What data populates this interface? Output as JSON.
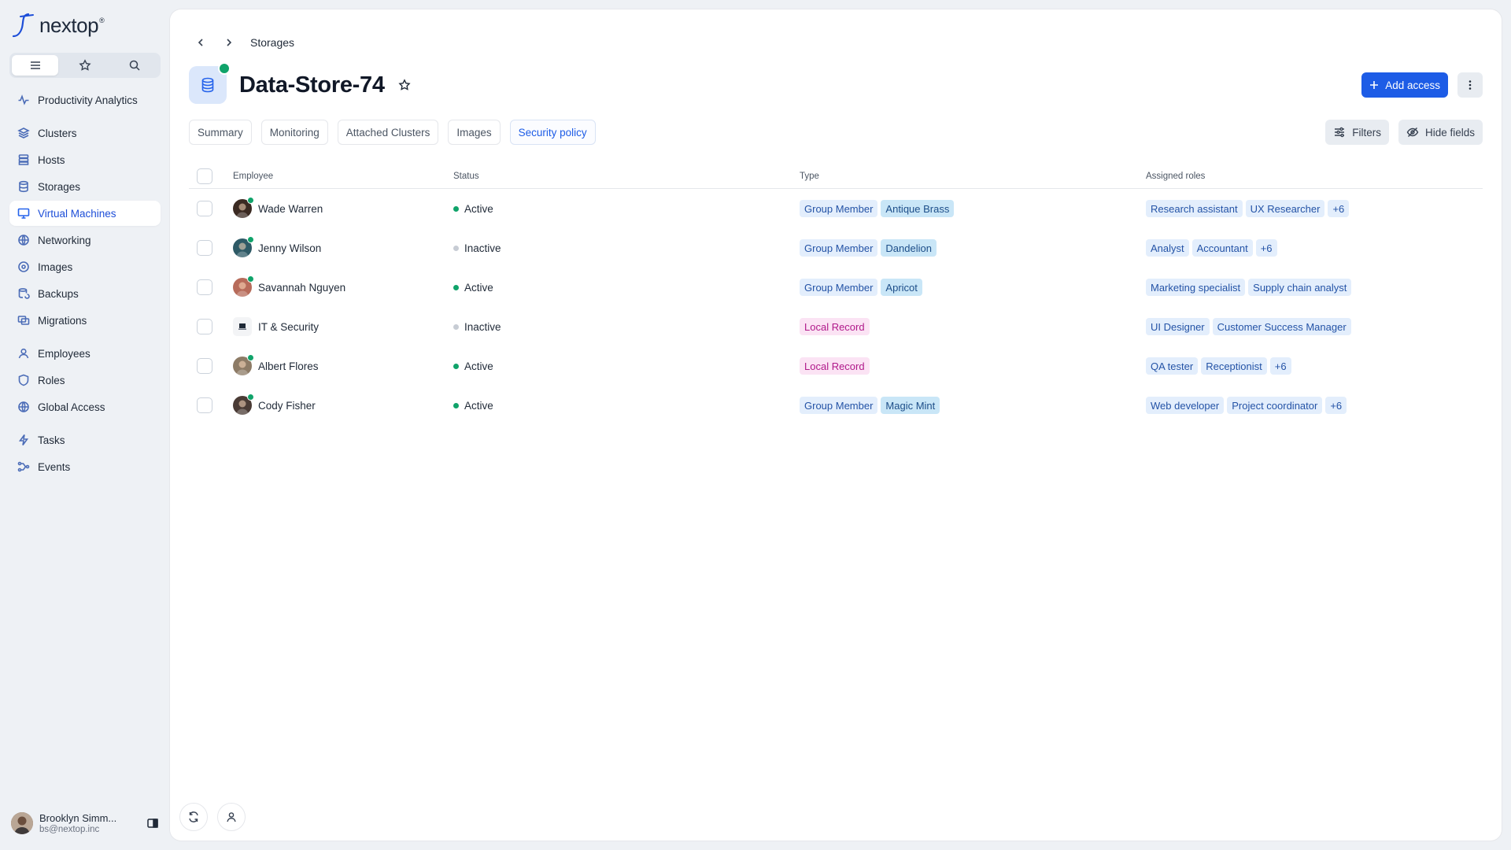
{
  "brand": {
    "name": "nextop",
    "mark": "®"
  },
  "sidebar": {
    "groups": [
      [
        {
          "label": "Productivity Analytics",
          "icon": "activity-icon"
        }
      ],
      [
        {
          "label": "Clusters",
          "icon": "layers-icon"
        },
        {
          "label": "Hosts",
          "icon": "server-icon"
        },
        {
          "label": "Storages",
          "icon": "database-icon"
        },
        {
          "label": "Virtual Machines",
          "icon": "monitor-icon",
          "active": true
        },
        {
          "label": "Networking",
          "icon": "network-icon"
        },
        {
          "label": "Images",
          "icon": "disc-icon"
        },
        {
          "label": "Backups",
          "icon": "backup-icon"
        },
        {
          "label": "Migrations",
          "icon": "migrate-icon"
        }
      ],
      [
        {
          "label": "Employees",
          "icon": "user-icon"
        },
        {
          "label": "Roles",
          "icon": "shield-icon"
        },
        {
          "label": "Global Access",
          "icon": "globe-icon"
        }
      ],
      [
        {
          "label": "Tasks",
          "icon": "bolt-icon"
        },
        {
          "label": "Events",
          "icon": "events-icon"
        }
      ]
    ],
    "user": {
      "name": "Brooklyn Simm...",
      "email": "bs@nextop.inc"
    }
  },
  "breadcrumb": {
    "current": "Storages"
  },
  "header": {
    "title": "Data-Store-74",
    "add_label": "Add access"
  },
  "tabs": [
    {
      "label": "Summary"
    },
    {
      "label": "Monitoring"
    },
    {
      "label": "Attached Clusters"
    },
    {
      "label": "Images"
    },
    {
      "label": "Security policy",
      "active": true
    }
  ],
  "tools": {
    "filters": "Filters",
    "hide_fields": "Hide fields"
  },
  "table": {
    "headers": {
      "employee": "Employee",
      "status": "Status",
      "type": "Type",
      "roles": "Assigned roles"
    },
    "rows": [
      {
        "name": "Wade Warren",
        "status": "Active",
        "online": true,
        "avatar": "#3b2a22",
        "type": "Group Member",
        "team": "Antique Brass",
        "roles": [
          "Research assistant",
          "UX Researcher",
          "+6"
        ]
      },
      {
        "name": "Jenny Wilson",
        "status": "Inactive",
        "online": true,
        "avatar": "#2e5a66",
        "type": "Group Member",
        "team": "Dandelion",
        "roles": [
          "Analyst",
          "Accountant",
          "+6"
        ]
      },
      {
        "name": "Savannah Nguyen",
        "status": "Active",
        "online": true,
        "avatar": "#b76b5a",
        "type": "Group Member",
        "team": "Apricot",
        "roles": [
          "Marketing specialist",
          "Supply chain analyst"
        ]
      },
      {
        "name": "IT & Security",
        "status": "Inactive",
        "online": false,
        "avatar": "square",
        "type": "Local Record",
        "team": "",
        "roles": [
          "UI Designer",
          "Customer Success Manager"
        ]
      },
      {
        "name": "Albert Flores",
        "status": "Active",
        "online": true,
        "avatar": "#8d7b66",
        "type": "Local Record",
        "team": "",
        "roles": [
          "QA tester",
          "Receptionist",
          "+6"
        ]
      },
      {
        "name": "Cody Fisher",
        "status": "Active",
        "online": true,
        "avatar": "#4a3b35",
        "type": "Group Member",
        "team": "Magic Mint",
        "roles": [
          "Web developer",
          "Project coordinator",
          "+6"
        ]
      }
    ]
  },
  "colors": {
    "accent": "#1d5ce6",
    "active": "#10a36a",
    "inactive": "#c7ccd4"
  }
}
